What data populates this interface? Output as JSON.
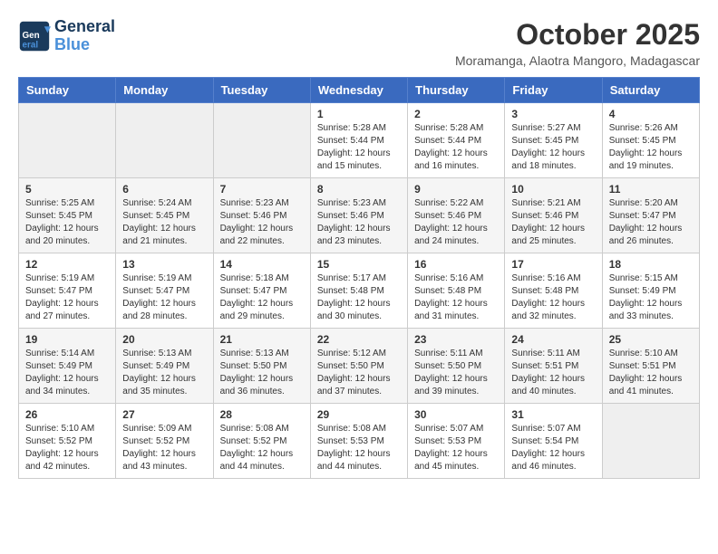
{
  "header": {
    "logo_line1": "General",
    "logo_line2": "Blue",
    "month": "October 2025",
    "location": "Moramanga, Alaotra Mangoro, Madagascar"
  },
  "weekdays": [
    "Sunday",
    "Monday",
    "Tuesday",
    "Wednesday",
    "Thursday",
    "Friday",
    "Saturday"
  ],
  "weeks": [
    [
      {
        "day": "",
        "info": ""
      },
      {
        "day": "",
        "info": ""
      },
      {
        "day": "",
        "info": ""
      },
      {
        "day": "1",
        "info": "Sunrise: 5:28 AM\nSunset: 5:44 PM\nDaylight: 12 hours\nand 15 minutes."
      },
      {
        "day": "2",
        "info": "Sunrise: 5:28 AM\nSunset: 5:44 PM\nDaylight: 12 hours\nand 16 minutes."
      },
      {
        "day": "3",
        "info": "Sunrise: 5:27 AM\nSunset: 5:45 PM\nDaylight: 12 hours\nand 18 minutes."
      },
      {
        "day": "4",
        "info": "Sunrise: 5:26 AM\nSunset: 5:45 PM\nDaylight: 12 hours\nand 19 minutes."
      }
    ],
    [
      {
        "day": "5",
        "info": "Sunrise: 5:25 AM\nSunset: 5:45 PM\nDaylight: 12 hours\nand 20 minutes."
      },
      {
        "day": "6",
        "info": "Sunrise: 5:24 AM\nSunset: 5:45 PM\nDaylight: 12 hours\nand 21 minutes."
      },
      {
        "day": "7",
        "info": "Sunrise: 5:23 AM\nSunset: 5:46 PM\nDaylight: 12 hours\nand 22 minutes."
      },
      {
        "day": "8",
        "info": "Sunrise: 5:23 AM\nSunset: 5:46 PM\nDaylight: 12 hours\nand 23 minutes."
      },
      {
        "day": "9",
        "info": "Sunrise: 5:22 AM\nSunset: 5:46 PM\nDaylight: 12 hours\nand 24 minutes."
      },
      {
        "day": "10",
        "info": "Sunrise: 5:21 AM\nSunset: 5:46 PM\nDaylight: 12 hours\nand 25 minutes."
      },
      {
        "day": "11",
        "info": "Sunrise: 5:20 AM\nSunset: 5:47 PM\nDaylight: 12 hours\nand 26 minutes."
      }
    ],
    [
      {
        "day": "12",
        "info": "Sunrise: 5:19 AM\nSunset: 5:47 PM\nDaylight: 12 hours\nand 27 minutes."
      },
      {
        "day": "13",
        "info": "Sunrise: 5:19 AM\nSunset: 5:47 PM\nDaylight: 12 hours\nand 28 minutes."
      },
      {
        "day": "14",
        "info": "Sunrise: 5:18 AM\nSunset: 5:47 PM\nDaylight: 12 hours\nand 29 minutes."
      },
      {
        "day": "15",
        "info": "Sunrise: 5:17 AM\nSunset: 5:48 PM\nDaylight: 12 hours\nand 30 minutes."
      },
      {
        "day": "16",
        "info": "Sunrise: 5:16 AM\nSunset: 5:48 PM\nDaylight: 12 hours\nand 31 minutes."
      },
      {
        "day": "17",
        "info": "Sunrise: 5:16 AM\nSunset: 5:48 PM\nDaylight: 12 hours\nand 32 minutes."
      },
      {
        "day": "18",
        "info": "Sunrise: 5:15 AM\nSunset: 5:49 PM\nDaylight: 12 hours\nand 33 minutes."
      }
    ],
    [
      {
        "day": "19",
        "info": "Sunrise: 5:14 AM\nSunset: 5:49 PM\nDaylight: 12 hours\nand 34 minutes."
      },
      {
        "day": "20",
        "info": "Sunrise: 5:13 AM\nSunset: 5:49 PM\nDaylight: 12 hours\nand 35 minutes."
      },
      {
        "day": "21",
        "info": "Sunrise: 5:13 AM\nSunset: 5:50 PM\nDaylight: 12 hours\nand 36 minutes."
      },
      {
        "day": "22",
        "info": "Sunrise: 5:12 AM\nSunset: 5:50 PM\nDaylight: 12 hours\nand 37 minutes."
      },
      {
        "day": "23",
        "info": "Sunrise: 5:11 AM\nSunset: 5:50 PM\nDaylight: 12 hours\nand 39 minutes."
      },
      {
        "day": "24",
        "info": "Sunrise: 5:11 AM\nSunset: 5:51 PM\nDaylight: 12 hours\nand 40 minutes."
      },
      {
        "day": "25",
        "info": "Sunrise: 5:10 AM\nSunset: 5:51 PM\nDaylight: 12 hours\nand 41 minutes."
      }
    ],
    [
      {
        "day": "26",
        "info": "Sunrise: 5:10 AM\nSunset: 5:52 PM\nDaylight: 12 hours\nand 42 minutes."
      },
      {
        "day": "27",
        "info": "Sunrise: 5:09 AM\nSunset: 5:52 PM\nDaylight: 12 hours\nand 43 minutes."
      },
      {
        "day": "28",
        "info": "Sunrise: 5:08 AM\nSunset: 5:52 PM\nDaylight: 12 hours\nand 44 minutes."
      },
      {
        "day": "29",
        "info": "Sunrise: 5:08 AM\nSunset: 5:53 PM\nDaylight: 12 hours\nand 44 minutes."
      },
      {
        "day": "30",
        "info": "Sunrise: 5:07 AM\nSunset: 5:53 PM\nDaylight: 12 hours\nand 45 minutes."
      },
      {
        "day": "31",
        "info": "Sunrise: 5:07 AM\nSunset: 5:54 PM\nDaylight: 12 hours\nand 46 minutes."
      },
      {
        "day": "",
        "info": ""
      }
    ]
  ]
}
